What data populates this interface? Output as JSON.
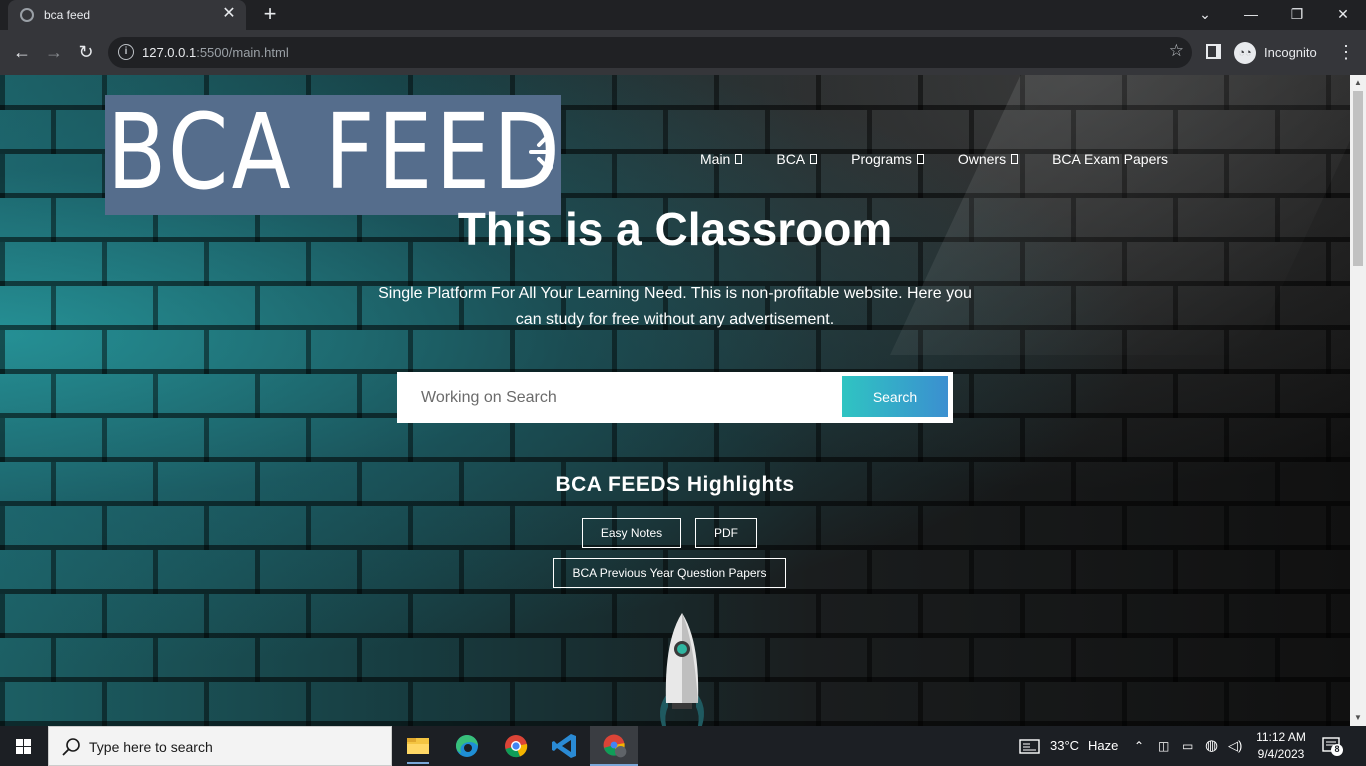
{
  "browser": {
    "tab_title": "bca feed",
    "url_host": "127.0.0.1",
    "url_rest": ":5500/main.html",
    "incognito_label": "Incognito"
  },
  "page": {
    "logo_text": "BCA FEED",
    "nav": [
      "Main",
      "BCA",
      "Programs",
      "Owners",
      "BCA Exam Papers"
    ],
    "hero_title": "This is a Classroom",
    "hero_subtitle": "Single Platform For All Your Learning Need. This is non-profitable website. Here you can study for free without any advertisement.",
    "search_placeholder": "Working on Search",
    "search_button": "Search",
    "highlights_title": "BCA FEEDS Highlights",
    "highlight_buttons": [
      "Easy Notes",
      "PDF",
      "BCA Previous Year Question Papers"
    ]
  },
  "taskbar": {
    "search_placeholder": "Type here to search",
    "weather_temp": "33°C",
    "weather_desc": "Haze",
    "time": "11:12 AM",
    "date": "9/4/2023",
    "notification_count": "8",
    "apps": [
      "file-explorer-icon",
      "edge-icon",
      "chrome-icon",
      "vscode-icon",
      "chrome-incognito-icon"
    ]
  },
  "colors": {
    "logo_bg": "#556d8c",
    "search_btn_start": "#2fc4c2",
    "search_btn_end": "#3b8fd0"
  }
}
